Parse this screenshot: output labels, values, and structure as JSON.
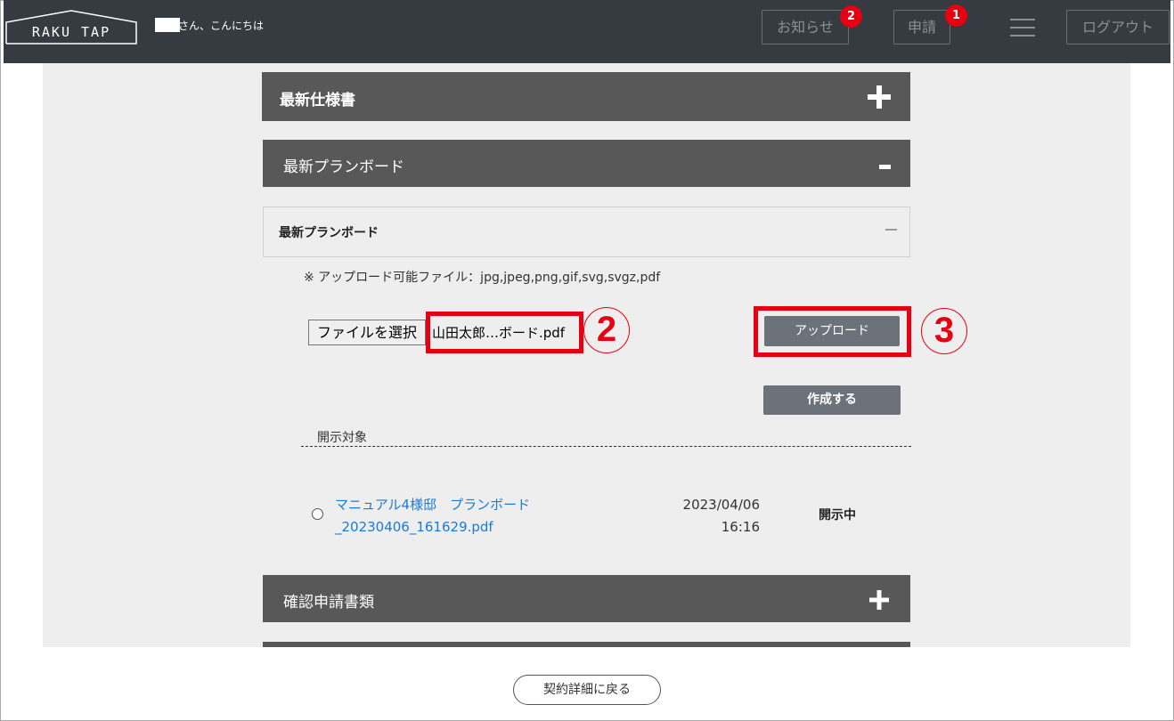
{
  "header": {
    "logo_text": "RAKU TAP",
    "greeting": "さん、こんにちは",
    "notice_label": "お知らせ",
    "notice_badge": "2",
    "apply_label": "申請",
    "apply_badge": "1",
    "logout_label": "ログアウト"
  },
  "sections": {
    "spec": {
      "title": "最新仕様書",
      "icon": "plus-icon"
    },
    "planboard": {
      "title": "最新プランボード",
      "icon": "minus-icon"
    },
    "confirm": {
      "title": "確認申請書類",
      "icon": "plus-icon"
    }
  },
  "planboard_panel": {
    "title": "最新プランボード",
    "note": "※ アップロード可能ファイル：jpg,jpeg,png,gif,svg,svgz,pdf",
    "file_select_label": "ファイルを選択",
    "selected_file": "山田太郎…ボード.pdf",
    "upload_label": "アップロード",
    "create_label": "作成する",
    "disclosure_label": "開示対象",
    "files": [
      {
        "name": "マニュアル4様邸　プランボード_20230406_161629.pdf",
        "date": "2023/04/06",
        "time": "16:16",
        "status": "開示中"
      }
    ]
  },
  "annotations": {
    "step2": "2",
    "step3": "3",
    "highlight_color": "#e60012"
  },
  "footer": {
    "back_label": "契約詳細に戻る"
  },
  "colors": {
    "header_bg": "#363a41",
    "accordion_bg": "#585858",
    "button_bg": "#6c727a",
    "link": "#1a7bd6"
  }
}
